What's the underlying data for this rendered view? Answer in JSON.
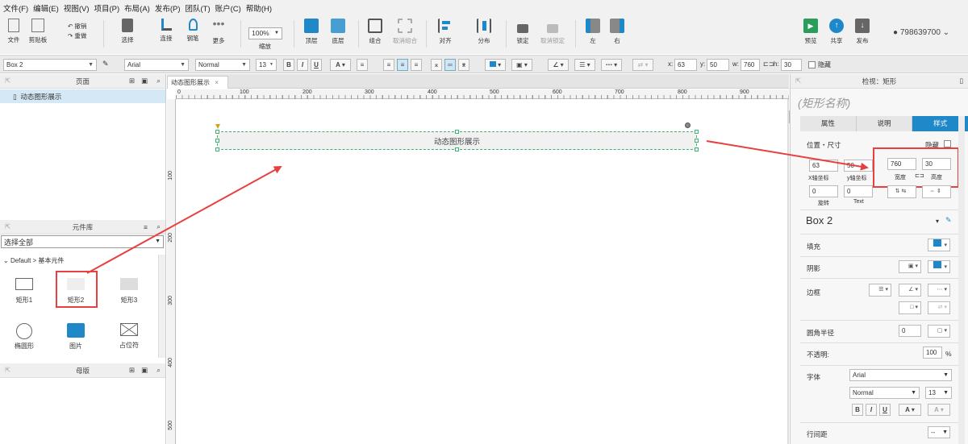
{
  "menu": [
    "文件(F)",
    "编辑(E)",
    "视图(V)",
    "项目(P)",
    "布局(A)",
    "发布(P)",
    "团队(T)",
    "账户(C)",
    "帮助(H)"
  ],
  "toolbar": {
    "file": "文件",
    "clipboard": "剪贴板",
    "undo": "撤销",
    "redo": "重做",
    "select": "选择",
    "connect": "连接",
    "pen": "钢笔",
    "more": "更多",
    "zoom_value": "100%",
    "zoom": "缩放",
    "top": "顶层",
    "bottom": "底层",
    "group": "组合",
    "ungroup": "取消组合",
    "align": "对齐",
    "distribute": "分布",
    "lock": "锁定",
    "unlock": "取消锁定",
    "left": "左",
    "right": "右",
    "preview": "预览",
    "share": "共享",
    "publish": "发布",
    "user": "798639700"
  },
  "format": {
    "element": "Box 2",
    "font": "Arial",
    "weight": "Normal",
    "size": "13",
    "x_label": "x:",
    "x": "63",
    "y_label": "y:",
    "y": "50",
    "w_label": "w:",
    "w": "760",
    "h_label": "h:",
    "h": "30",
    "hidden": "隐藏"
  },
  "pages": {
    "title": "页面",
    "items": [
      "动态图形展示"
    ]
  },
  "library": {
    "title": "元件库",
    "select": "选择全部",
    "tree": "Default > 基本元件",
    "widgets": [
      "矩形1",
      "矩形2",
      "矩形3",
      "椭圆形",
      "图片",
      "占位符"
    ]
  },
  "masters": {
    "title": "母版"
  },
  "tab": {
    "label": "动态图形展示"
  },
  "ruler": [
    "0",
    "100",
    "200",
    "300",
    "400",
    "500",
    "600",
    "700",
    "800",
    "900"
  ],
  "vruler": [
    "100",
    "200",
    "300",
    "400",
    "500"
  ],
  "box": {
    "text": "动态图形展示"
  },
  "inspector": {
    "title": "检视：矩形",
    "name_placeholder": "(矩形名称)",
    "tabs": [
      "属性",
      "说明",
      "样式"
    ],
    "pos_size": "位置・尺寸",
    "hidden": "隐藏",
    "x": "63",
    "y": "50",
    "w": "760",
    "h": "30",
    "x_label": "X轴坐标",
    "y_label": "y轴坐标",
    "w_label": "宽度",
    "h_label": "高度",
    "rotate": "0",
    "text_rotate": "0",
    "rotate_label": "旋转",
    "text_label": "Text",
    "style_name": "Box 2",
    "fill": "填充",
    "shadow": "阴影",
    "border": "边框",
    "radius": "圆角半径",
    "radius_value": "0",
    "opacity": "不透明:",
    "opacity_value": "100",
    "percent": "%",
    "font": "字体",
    "font_value": "Arial",
    "weight_value": "Normal",
    "size_value": "13",
    "line_spacing": "行间距",
    "line_spacing_value": "--"
  },
  "colors": {
    "accent": "#1e88c9",
    "highlight": "#e84040",
    "selection": "#3cb371"
  }
}
